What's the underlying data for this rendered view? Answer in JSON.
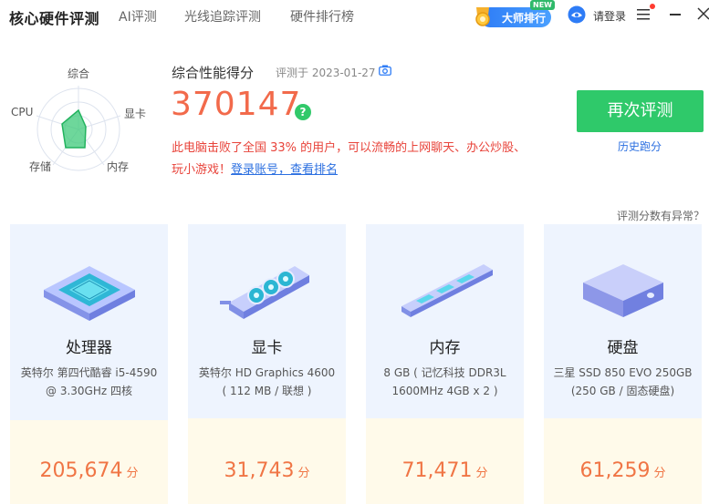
{
  "app": {
    "title": "核心硬件评测"
  },
  "nav": {
    "tabs": [
      "AI评测",
      "光线追踪评测",
      "硬件排行榜"
    ]
  },
  "header": {
    "master_label": "大师排行",
    "new_badge": "NEW",
    "login_label": "请登录"
  },
  "radar": {
    "labels": [
      "综合",
      "显卡",
      "内存",
      "存储",
      "CPU"
    ]
  },
  "score": {
    "heading": "综合性能得分",
    "date": "评测于 2023-01-27",
    "value": "370147",
    "help_symbol": "?",
    "desc_line1": "此电脑击败了全国 33% 的用户，可以流畅的上网聊天、办公炒股、",
    "desc_line2": "玩小游戏！",
    "rank_link": "登录账号，查看排名"
  },
  "actions": {
    "retest": "再次评测",
    "history": "历史跑分",
    "abnormal": "评测分数有异常？"
  },
  "cards": [
    {
      "title": "处理器",
      "spec": "英特尔 第四代酷睿 i5-4590 @ 3.30GHz 四核",
      "score": "205,674",
      "unit": "分"
    },
    {
      "title": "显卡",
      "spec": "英特尔 HD Graphics 4600 ( 112 MB / 联想 )",
      "score": "31,743",
      "unit": "分"
    },
    {
      "title": "内存",
      "spec": "8 GB ( 记忆科技 DDR3L 1600MHz 4GB x 2 )",
      "score": "71,471",
      "unit": "分"
    },
    {
      "title": "硬盘",
      "spec": "三星 SSD 850 EVO 250GB (250 GB / 固态硬盘)",
      "score": "61,259",
      "unit": "分"
    }
  ],
  "colors": {
    "accent_green": "#2fc96a",
    "score_orange": "#f26a4b",
    "link_blue": "#2b6fe0",
    "card_blue": "#eef4fe",
    "card_yellow": "#fffaea"
  }
}
